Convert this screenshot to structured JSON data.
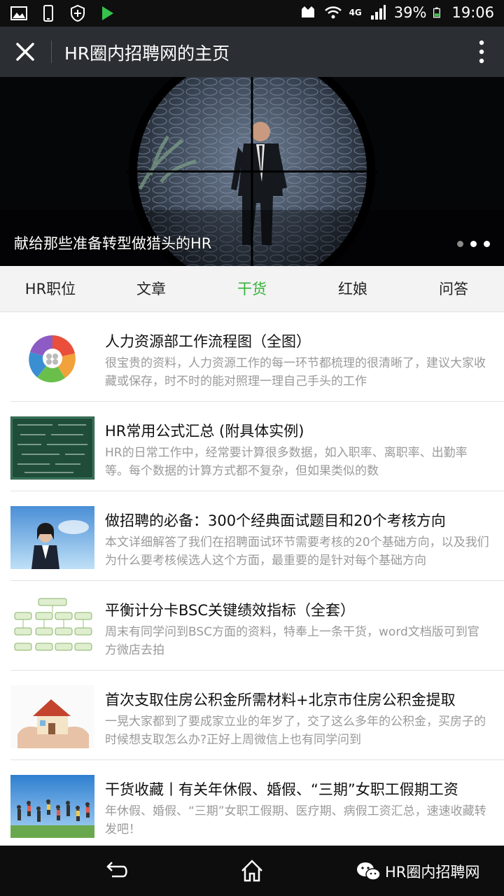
{
  "status_bar": {
    "icons_left": [
      "gallery-icon",
      "phone-icon",
      "shield-icon",
      "play-store-icon"
    ],
    "network": "4G",
    "battery": "39%",
    "time": "19:06"
  },
  "header": {
    "title": "HR圈内招聘网的主页"
  },
  "banner": {
    "caption": "献给那些准备转型做猎头的HR",
    "slide_count": 3,
    "active_slide": 3
  },
  "tabs": [
    {
      "label": "HR职位",
      "active": false
    },
    {
      "label": "文章",
      "active": false
    },
    {
      "label": "干货",
      "active": true
    },
    {
      "label": "红娘",
      "active": false
    },
    {
      "label": "问答",
      "active": false
    }
  ],
  "articles": [
    {
      "title": "人力资源部工作流程图（全图）",
      "desc": "很宝贵的资料，人力资源工作的每一环节都梳理的很清晰了，建议大家收藏或保存，时不时的能对照理一理自己手头的工作",
      "thumb": "hr-cycle-diagram"
    },
    {
      "title": "HR常用公式汇总 (附具体实例)",
      "desc": "HR的日常工作中，经常要计算很多数据，如入职率、离职率、出勤率等。每个数据的计算方式都不复杂，但如果类似的数",
      "thumb": "formula-blackboard"
    },
    {
      "title": "做招聘的必备：300个经典面试题目和20个考核方向",
      "desc": "本文详细解答了我们在招聘面试环节需要考核的20个基础方向，以及我们为什么要考核候选人这个方面，最重要的是针对每个基础方向",
      "thumb": "woman-portrait"
    },
    {
      "title": "平衡计分卡BSC关键绩效指标（全套）",
      "desc": "周末有同学问到BSC方面的资料，特奉上一条干货，word文档版可到官方微店去拍",
      "thumb": "bsc-chart"
    },
    {
      "title": "首次支取住房公积金所需材料+北京市住房公积金提取",
      "desc": "一晃大家都到了要成家立业的年岁了，交了这么多年的公积金，买房子的时候想支取怎么办?正好上周微信上也有同学问到",
      "thumb": "house-in-hands"
    },
    {
      "title": "干货收藏丨有关年休假、婚假、“三期”女职工假期工资",
      "desc": "年休假、婚假、“三期”女职工假期、医疗期、病假工资汇总，速速收藏转发吧！",
      "thumb": "jumping-crowd"
    }
  ],
  "nav_bar": {
    "watermark": "HR圈内招聘网"
  },
  "colors": {
    "accent_green": "#34b33a",
    "title_bar": "#2b2e33",
    "desc_gray": "#9a9a9a"
  }
}
